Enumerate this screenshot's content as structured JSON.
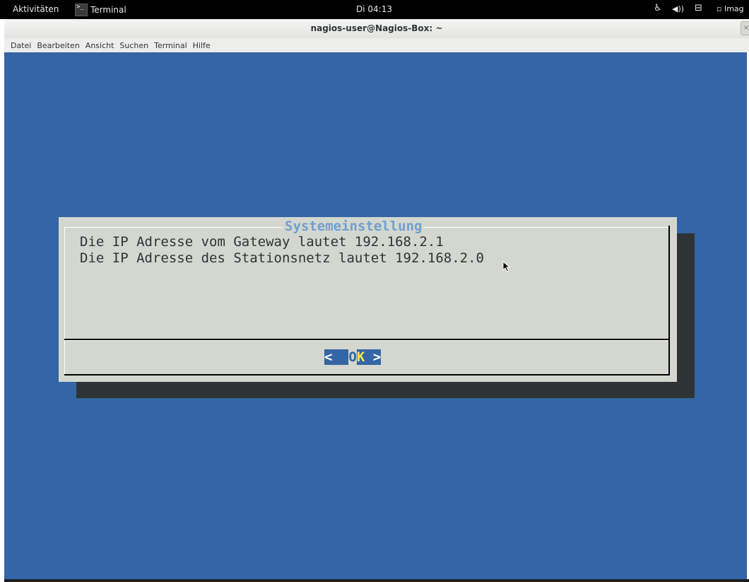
{
  "topbar": {
    "activities": "Aktivitäten",
    "app_name": "Terminal",
    "app_icon_glyph": ">_",
    "clock": "Di 04:13",
    "keyboard_label": "Imag"
  },
  "window": {
    "title": "nagios-user@Nagios-Box: ~"
  },
  "menu": [
    "Datei",
    "Bearbeiten",
    "Ansicht",
    "Suchen",
    "Terminal",
    "Hilfe"
  ],
  "dialog": {
    "title": "Systemeinstellung",
    "lines": [
      "Die IP Adresse vom Gateway lautet 192.168.2.1",
      "Die IP Adresse des Stationsnetz lautet 192.168.2.0"
    ],
    "button": {
      "left_bracket": "<",
      "pad_before": " ",
      "letter_normal": "O",
      "letter_hotkey": "K",
      "pad_after": " ",
      "right_bracket": ">"
    }
  },
  "colors": {
    "terminal_bg": "#3465a4",
    "dialog_bg": "#d3d7cf",
    "title_fg": "#729fcf",
    "hotkey_fg": "#fce94f"
  }
}
